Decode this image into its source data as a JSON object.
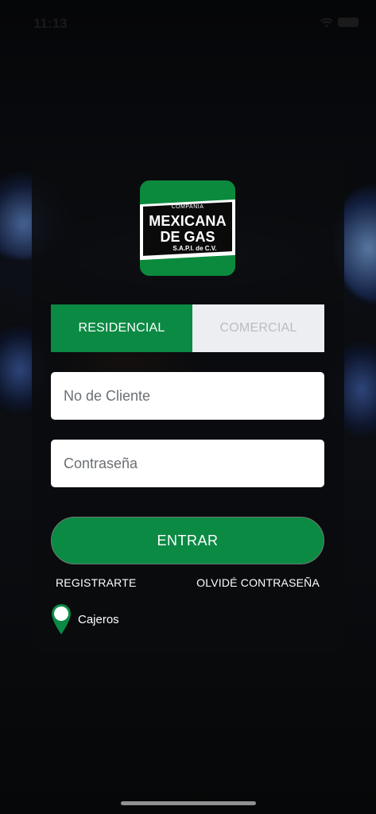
{
  "status_bar": {
    "time": "11:13",
    "wifi_icon": "wifi-icon",
    "battery_icon": "battery-icon"
  },
  "logo": {
    "top_text": "COMPAÑIA",
    "line1": "MEXICANA",
    "line2": "DE GAS",
    "line3": "S.A.P.I. de C.V."
  },
  "tabs": [
    {
      "label": "RESIDENCIAL",
      "selected": true
    },
    {
      "label": "COMERCIAL",
      "selected": false
    }
  ],
  "form": {
    "cliente_placeholder": "No de Cliente",
    "password_placeholder": "Contraseña"
  },
  "actions": {
    "entrar_label": "ENTRAR",
    "registrar_label": "REGISTRARTE",
    "olvide_label": "OLVIDÉ CONTRASEÑA"
  },
  "cajeros": {
    "label": "Cajeros",
    "icon": "map-pin-icon"
  },
  "colors": {
    "brand_green": "#0b8a44",
    "inactive_tab": "#eceef1",
    "card_bg": "#0a0b0e"
  }
}
